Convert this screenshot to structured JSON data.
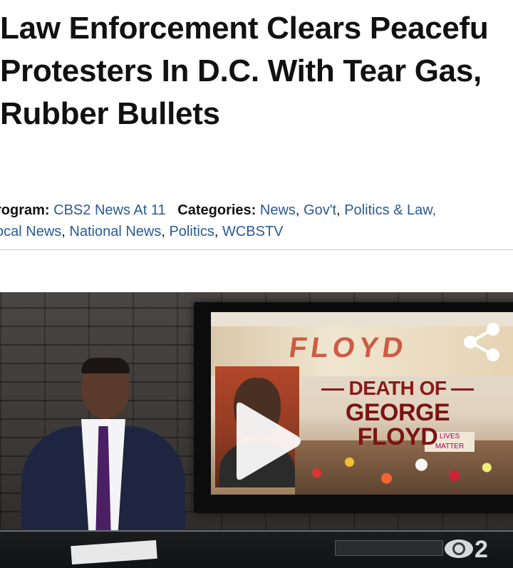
{
  "article": {
    "headline_lines": [
      "Law Enforcement Clears Peacefu",
      "Protesters In D.C. With Tear Gas,",
      "Rubber Bullets"
    ]
  },
  "meta": {
    "program_label": "rogram:",
    "program_value": "CBS2 News At 11",
    "categories_label": "Categories:",
    "categories": [
      "News",
      "Gov't",
      "Politics & Law,"
    ],
    "categories_line2": [
      "ocal News",
      "National News",
      "Politics",
      "WCBSTV"
    ]
  },
  "video": {
    "graphic_title_line1": "DEATH OF",
    "graphic_title_line2": "GEORGE FLOYD",
    "mural_text": "FLOYD",
    "memorial_sign": "LIVES MATTER",
    "channel_logo_text": "2",
    "icons": {
      "play": "play-icon",
      "share": "share-icon",
      "channel_logo": "cbs-eye-logo-icon"
    },
    "colors": {
      "graphic_title": "#8b1a1a",
      "play": "#ffffff"
    }
  },
  "colors": {
    "link": "#2a5a96",
    "text": "#111111",
    "divider": "#c9c9c9"
  }
}
